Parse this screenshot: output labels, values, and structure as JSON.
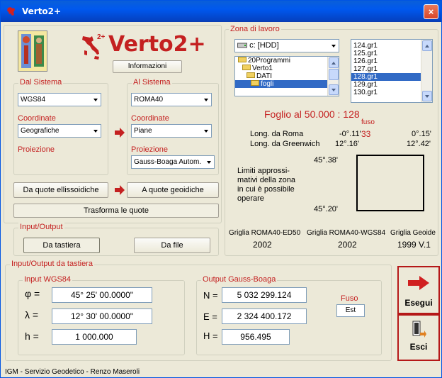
{
  "window": {
    "title": "Verto2+",
    "close_symbol": "×"
  },
  "app": {
    "logo_text": "Verto2+",
    "info_button": "Informazioni"
  },
  "dal": {
    "legend": "Dal Sistema",
    "system": "WGS84",
    "coord_label": "Coordinate",
    "coord_value": "Geografiche",
    "proj_label": "Proiezione"
  },
  "al": {
    "legend": "Al Sistema",
    "system": "ROMA40",
    "coord_label": "Coordinate",
    "coord_value": "Piane",
    "proj_label": "Proiezione",
    "proj_value": "Gauss-Boaga Autom."
  },
  "quote": {
    "from": "Da quote ellissoidiche",
    "to": "A quote geoidiche",
    "transform": "Trasforma le quote"
  },
  "io": {
    "legend": "Input/Output",
    "keyboard": "Da tastiera",
    "file": "Da file"
  },
  "zona": {
    "legend": "Zona di lavoro",
    "drive": "c: [HDD]",
    "folders": [
      "20Programmi",
      "Verto1",
      "DATI",
      "fogli"
    ],
    "files": [
      "124.gr1",
      "125.gr1",
      "126.gr1",
      "127.gr1",
      "128.gr1",
      "129.gr1",
      "130.gr1"
    ],
    "selected_file": "128.gr1",
    "foglio": "Foglio al 50.000 : 128",
    "fuso_label": "fuso",
    "long_roma_label": "Long. da Roma",
    "long_roma_1": "-0°.11'",
    "fuso_value": "33",
    "long_roma_2": "0°.15'",
    "long_green_label": "Long. da Greenwich",
    "long_green_1": "12°.16'",
    "long_green_2": "12°.42'",
    "lat_top": "45°.38'",
    "lat_bottom": "45°.20'",
    "limiti": [
      "Limiti approssi-",
      "mativi della zona",
      "in cui è possibile",
      "operare"
    ],
    "grid1_label": "Griglia ROMA40-ED50",
    "grid1_value": "2002",
    "grid2_label": "Griglia ROMA40-WGS84",
    "grid2_value": "2002",
    "grid3_label": "Griglia Geoide",
    "grid3_value": "1999 V.1"
  },
  "input_output": {
    "legend": "Input/Output da tastiera",
    "input_legend": "Input WGS84",
    "phi_label": "φ =",
    "phi_value": "45° 25' 00.0000\"",
    "lambda_label": "λ =",
    "lambda_value": "12° 30' 00.0000\"",
    "h_label": "h =",
    "h_value": "1 000.000",
    "output_legend": "Output Gauss-Boaga",
    "n_label": "N =",
    "n_value": "5 032 299.124",
    "e_label": "E =",
    "e_value": "2 324 400.172",
    "hh_label": "H =",
    "hh_value": "956.495",
    "fuso_label": "Fuso",
    "fuso_value": "Est"
  },
  "actions": {
    "run": "Esegui",
    "exit": "Esci"
  },
  "footer": "IGM - Servizio Geodetico - Renzo Maseroli",
  "colors": {
    "accent_red": "#c42020",
    "selection_blue": "#316ac5"
  }
}
